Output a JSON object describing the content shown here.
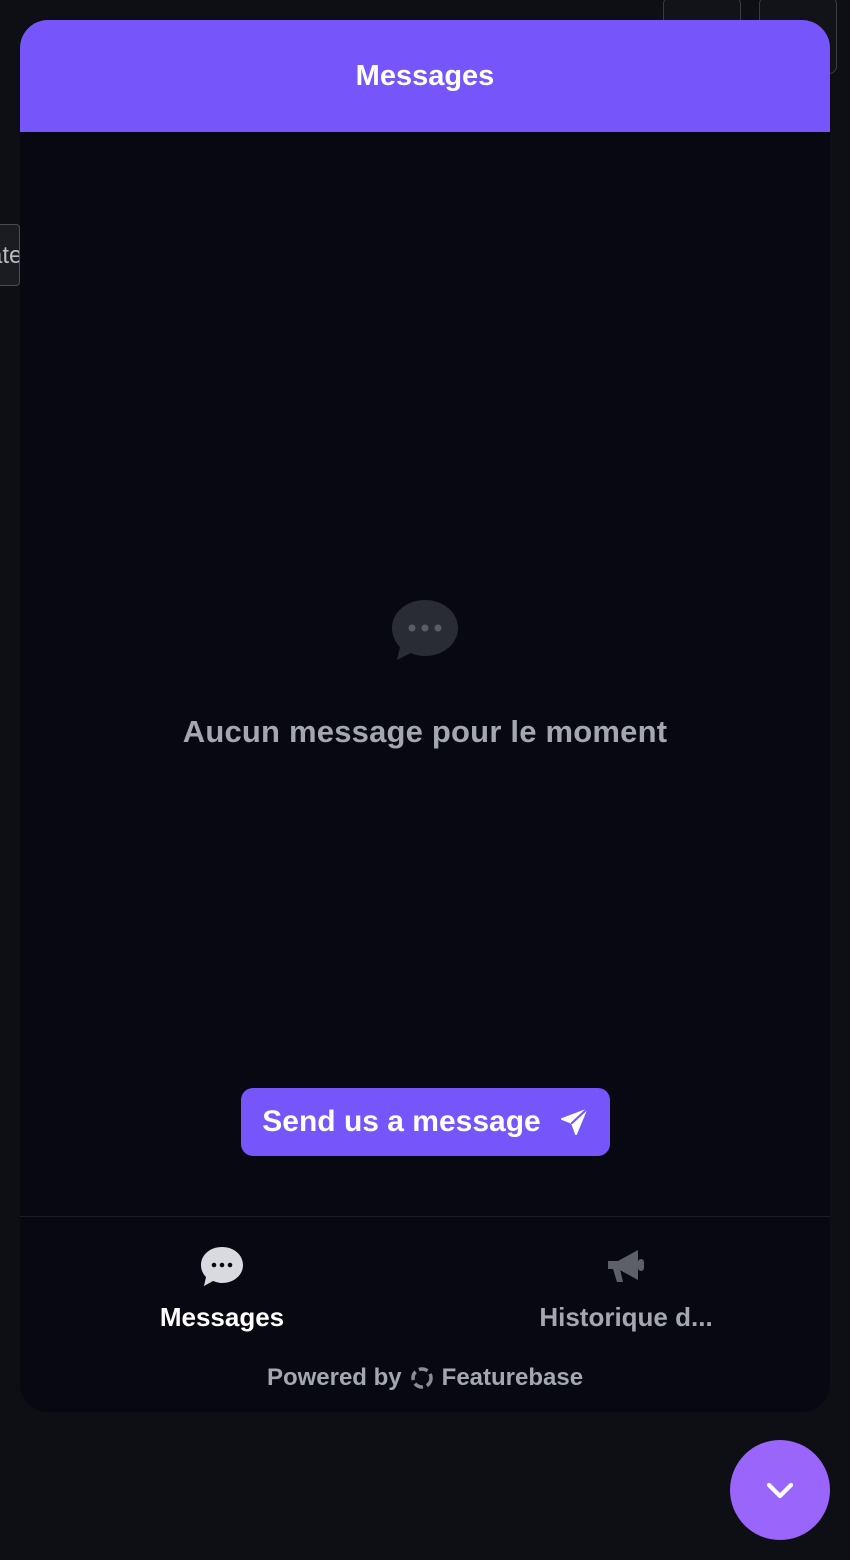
{
  "background": {
    "tab_fragment": "ate"
  },
  "widget": {
    "header_title": "Messages",
    "empty_state": {
      "icon": "chat-bubble-icon",
      "text": "Aucun message pour le moment"
    },
    "send_button": {
      "label": "Send us a message",
      "icon": "paper-plane-icon"
    },
    "nav": [
      {
        "label": "Messages",
        "icon": "chat-bubble-icon",
        "active": true
      },
      {
        "label": "Historique d...",
        "icon": "megaphone-icon",
        "active": false
      }
    ],
    "powered_by": {
      "prefix": "Powered by",
      "brand": "Featurebase",
      "icon": "featurebase-logo-icon"
    }
  },
  "fab": {
    "icon": "chevron-down-icon"
  },
  "colors": {
    "accent": "#7655fb",
    "fab": "#9a65fb",
    "panel_bg": "#070811",
    "page_bg": "#0d0f15",
    "muted_text": "#a5a7b0"
  }
}
